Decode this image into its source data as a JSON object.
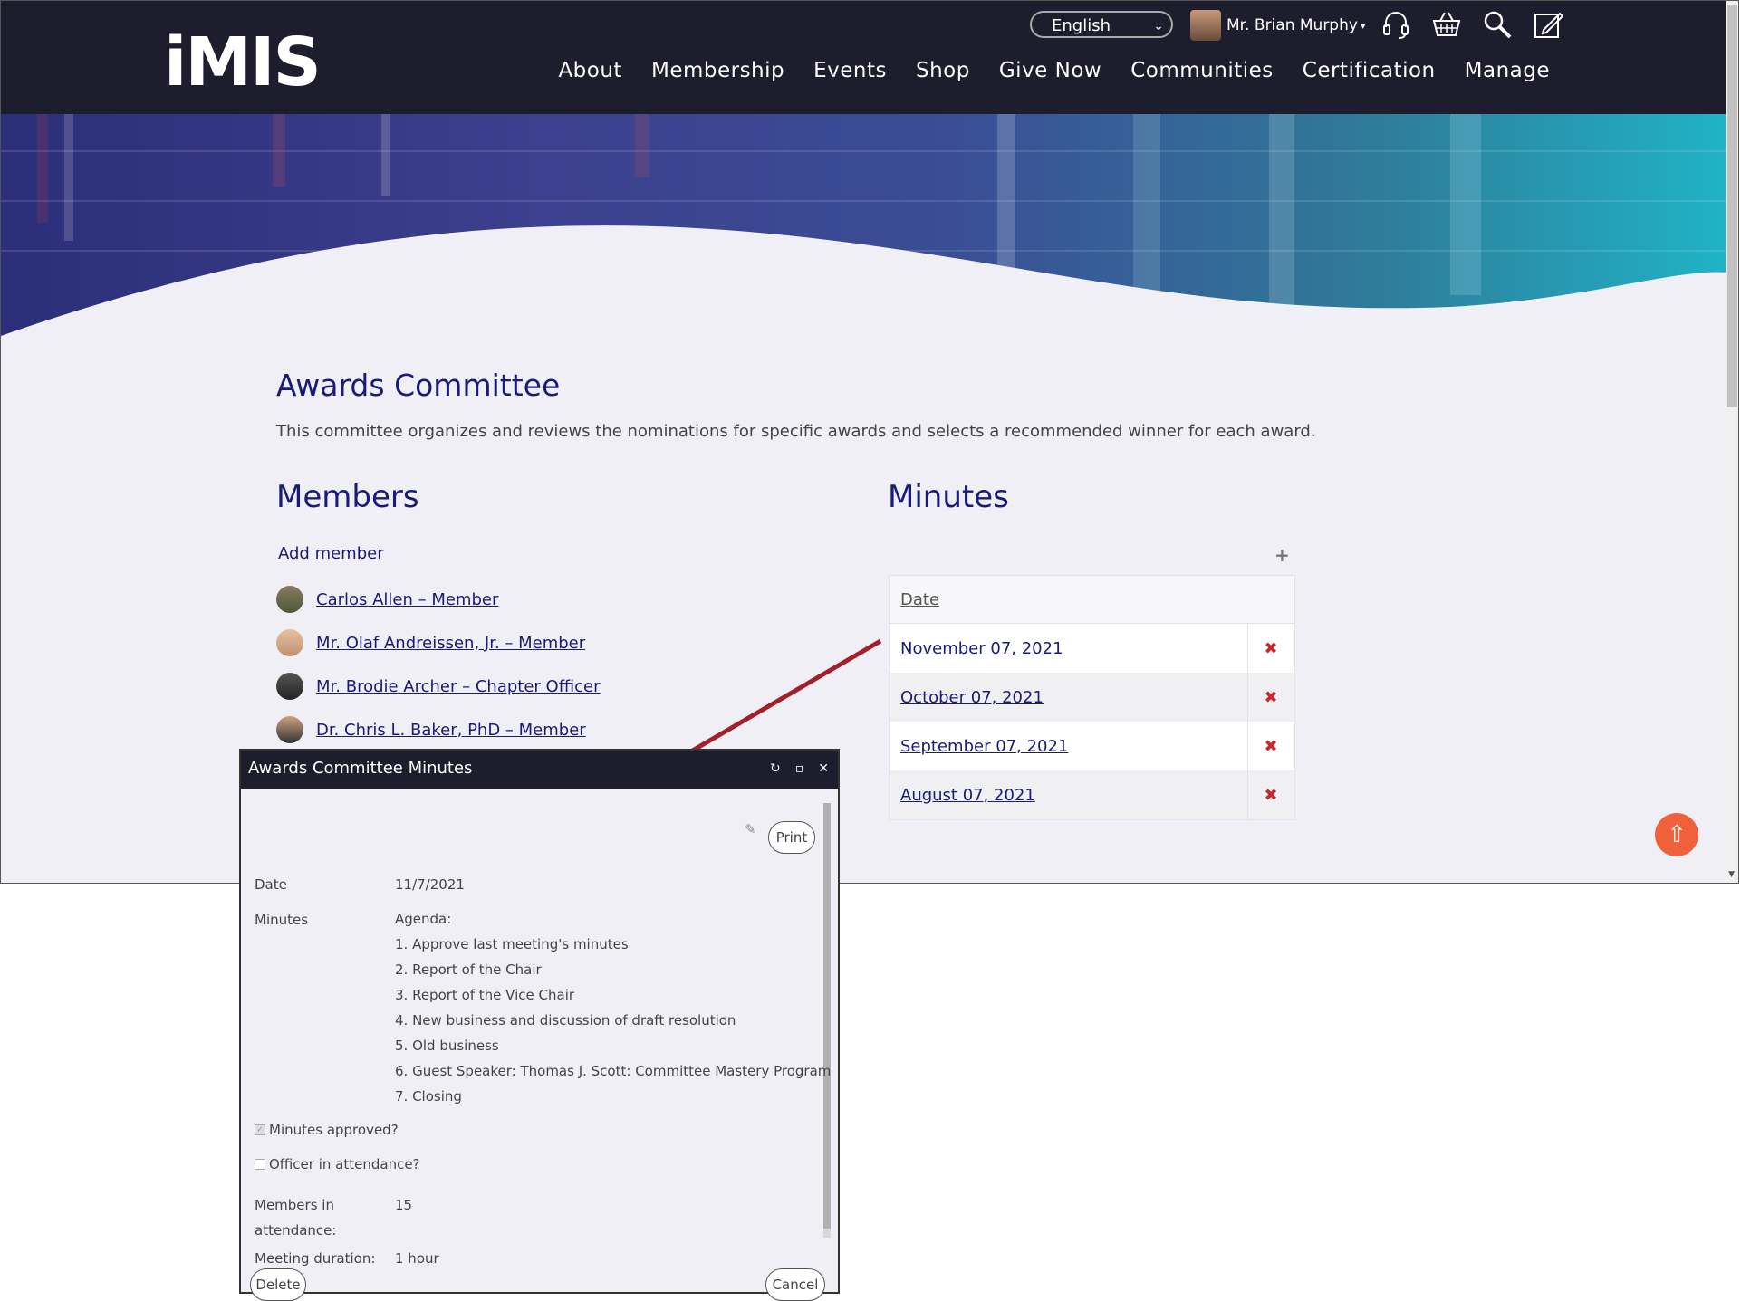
{
  "header": {
    "logo": "iMIS",
    "language": "English",
    "user_name": "Mr. Brian Murphy",
    "user_caret": "▾",
    "icons": [
      "headset-icon",
      "basket-icon",
      "search-icon",
      "edit-icon"
    ],
    "nav": [
      "About",
      "Membership",
      "Events",
      "Shop",
      "Give Now",
      "Communities",
      "Certification",
      "Manage"
    ]
  },
  "page": {
    "title": "Awards Committee",
    "description": "This committee organizes and reviews the nominations for specific awards and selects a recommended winner for each award.",
    "members_heading": "Members",
    "minutes_heading": "Minutes",
    "add_member": "Add member",
    "add_minutes_icon": "+",
    "members": [
      "Carlos Allen – Member",
      "Mr. Olaf Andreissen, Jr. – Member",
      "Mr. Brodie Archer – Chapter Officer",
      "Dr. Chris L. Baker, PhD – Member"
    ],
    "minutes_table": {
      "header": "Date",
      "rows": [
        "November 07, 2021",
        "October 07, 2021",
        "September 07, 2021",
        "August 07, 2021"
      ],
      "delete_icon": "✖"
    },
    "back_to_top_icon": "⇧"
  },
  "dialog": {
    "title": "Awards Committee Minutes",
    "controls": {
      "refresh": "↻",
      "maximize": "▫",
      "close": "✕"
    },
    "print_label": "Print",
    "date_label": "Date",
    "date_value": "11/7/2021",
    "minutes_label": "Minutes",
    "agenda": [
      "Agenda:",
      "1. Approve last meeting's minutes",
      "2. Report of the Chair",
      "3. Report of the Vice Chair",
      "4. New business and discussion of draft resolution",
      "5. Old business",
      "6. Guest Speaker: Thomas J. Scott: Committee Mastery Program",
      "7. Closing"
    ],
    "minutes_approved_label": "Minutes approved?",
    "officer_label": "Officer in attendance?",
    "members_attendance_label_1": "Members in",
    "members_attendance_label_2": "attendance:",
    "members_attendance_value": "15",
    "duration_label": "Meeting duration:",
    "duration_value": "1 hour",
    "delete_label": "Delete",
    "cancel_label": "Cancel"
  },
  "colors": {
    "accent": "#1a1a7a",
    "topbar": "#1d1d2e",
    "delete": "#c8282e",
    "arrow": "#a3202a",
    "to_top": "#f0603a"
  }
}
